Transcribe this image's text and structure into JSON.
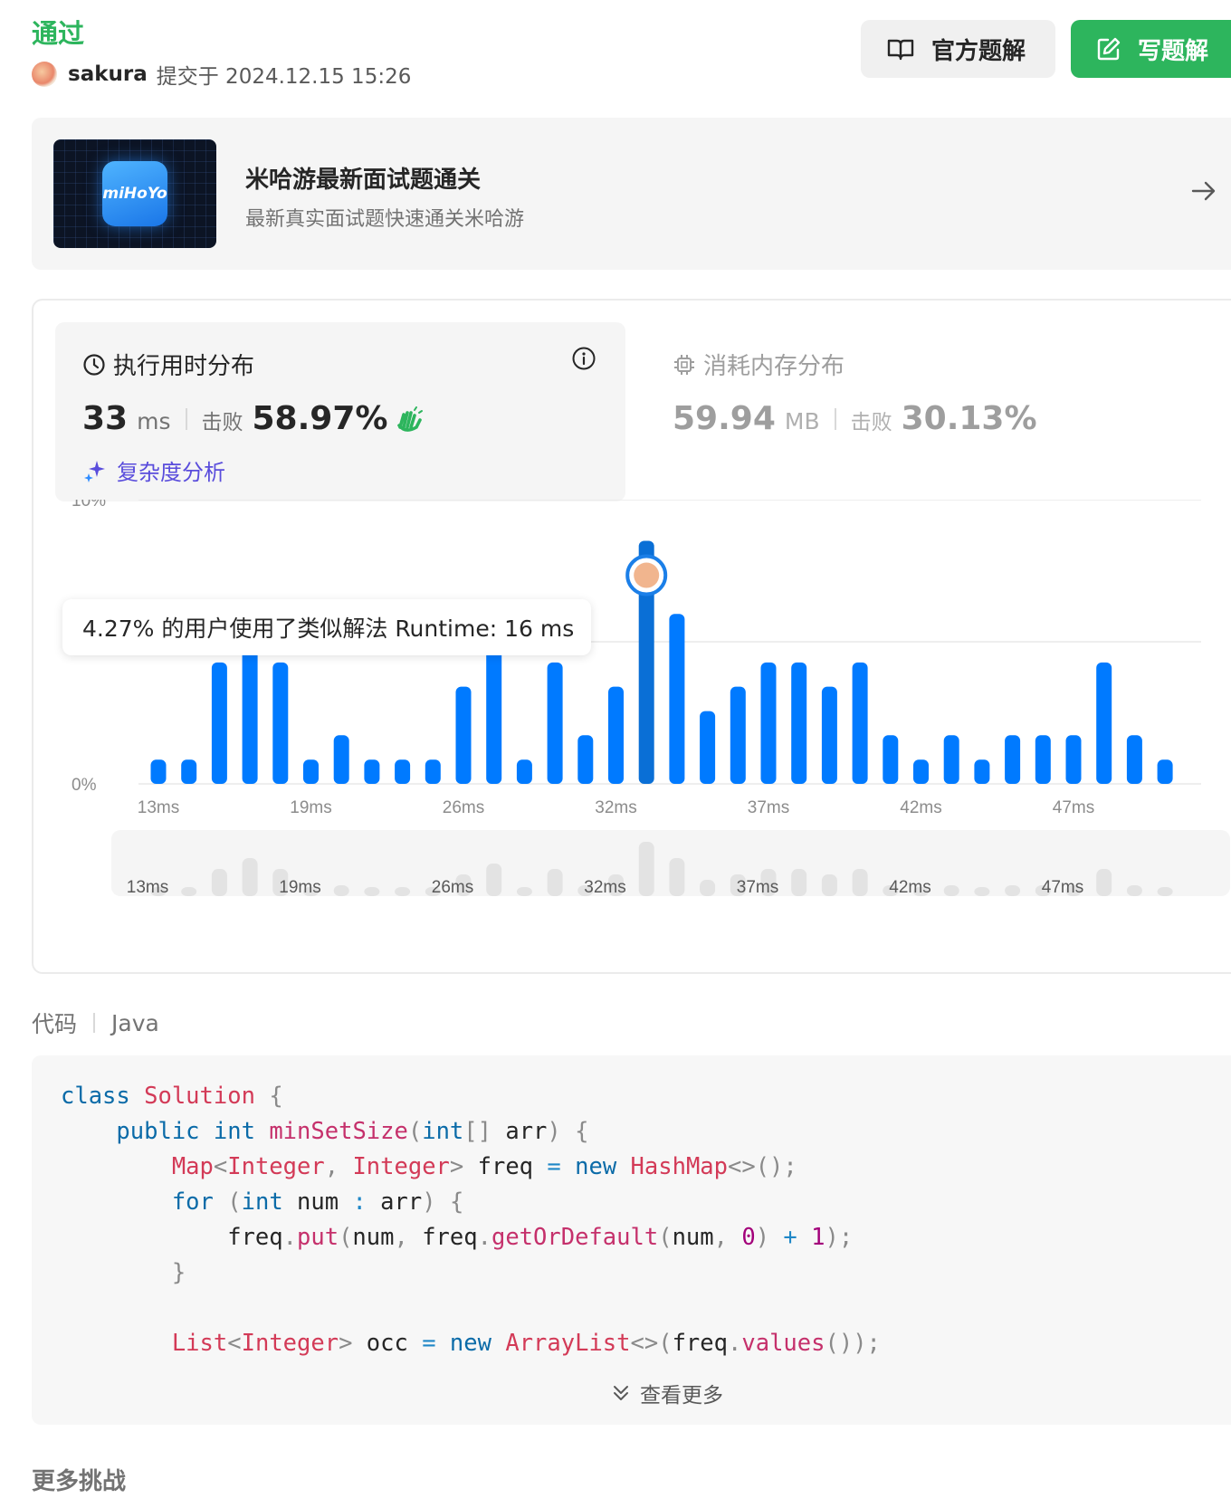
{
  "status": "通过",
  "submission": {
    "user": "sakura",
    "submitted_text": "提交于 2024.12.15 15:26"
  },
  "buttons": {
    "official_solution": "官方题解",
    "write_solution": "写题解"
  },
  "promo": {
    "logo_text": "miHoYo",
    "title": "米哈游最新面试题通关",
    "subtitle": "最新真实面试题快速通关米哈游"
  },
  "runtime": {
    "title": "执行用时分布",
    "value": "33",
    "unit": "ms",
    "beat_label": "击败",
    "beat_percent": "58.97%",
    "complexity_link": "复杂度分析"
  },
  "memory": {
    "title": "消耗内存分布",
    "value": "59.94",
    "unit": "MB",
    "beat_label": "击败",
    "beat_percent": "30.13%"
  },
  "tooltip": {
    "text": "4.27% 的用户使用了类似解法 Runtime: 16 ms"
  },
  "chart_data": {
    "type": "bar",
    "ylabel_ticks": [
      "10%",
      "5%",
      "0%"
    ],
    "ylim": [
      0,
      10
    ],
    "x_tick_labels": [
      "13ms",
      "19ms",
      "26ms",
      "32ms",
      "37ms",
      "42ms",
      "47ms"
    ],
    "values": [
      0.85,
      0.85,
      4.27,
      5.98,
      4.27,
      0.85,
      1.71,
      0.85,
      0.85,
      0.85,
      3.42,
      5.13,
      0.85,
      4.27,
      1.71,
      3.42,
      8.55,
      5.98,
      2.56,
      3.42,
      4.27,
      4.27,
      3.42,
      4.27,
      1.71,
      0.85,
      1.71,
      0.85,
      1.71,
      1.71,
      1.71,
      4.27,
      1.71,
      0.85
    ],
    "highlight_index": 16,
    "grid": true,
    "colors": {
      "bar": "#007aff",
      "highlight": "#0a6fd6",
      "mini_bar": "#e3e3e3",
      "grid": "#e8e8e8"
    },
    "mini_tick_labels": [
      "13ms",
      "19ms",
      "26ms",
      "32ms",
      "37ms",
      "42ms",
      "47ms"
    ]
  },
  "code_section": {
    "label": "代码",
    "language": "Java",
    "show_more": "查看更多"
  },
  "more_challenges": "更多挑战"
}
